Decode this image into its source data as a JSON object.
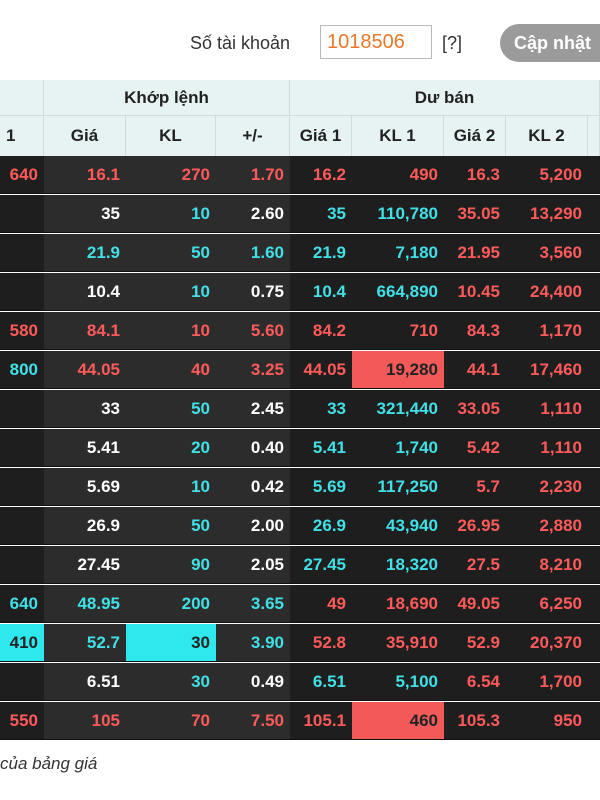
{
  "account": {
    "label": "Số tài khoản",
    "value": "1018506",
    "help": "[?]",
    "update_button": "Cập nhật"
  },
  "header": {
    "group_match": "Khớp lệnh",
    "group_ask": "Dư bán",
    "cols": [
      "1",
      "Giá",
      "KL",
      "+/-",
      "Giá 1",
      "KL 1",
      "Giá 2",
      "KL 2",
      ""
    ]
  },
  "rows": [
    {
      "bid": "640",
      "price": "16.1",
      "vol": "270",
      "chg": "1.70",
      "a1p": "16.2",
      "a1v": "490",
      "a2p": "16.3",
      "a2v": "5,200",
      "colors": [
        "red",
        "red",
        "red",
        "red",
        "red",
        "red",
        "red",
        "red"
      ]
    },
    {
      "bid": "",
      "price": "35",
      "vol": "10",
      "chg": "2.60",
      "a1p": "35",
      "a1v": "110,780",
      "a2p": "35.05",
      "a2v": "13,290",
      "colors": [
        "white",
        "white",
        "cyan",
        "white",
        "cyan",
        "cyan",
        "red",
        "red"
      ]
    },
    {
      "bid": "",
      "price": "21.9",
      "vol": "50",
      "chg": "1.60",
      "a1p": "21.9",
      "a1v": "7,180",
      "a2p": "21.95",
      "a2v": "3,560",
      "colors": [
        "white",
        "cyan",
        "cyan",
        "cyan",
        "cyan",
        "cyan",
        "red",
        "red"
      ]
    },
    {
      "bid": "",
      "price": "10.4",
      "vol": "10",
      "chg": "0.75",
      "a1p": "10.4",
      "a1v": "664,890",
      "a2p": "10.45",
      "a2v": "24,400",
      "colors": [
        "white",
        "white",
        "cyan",
        "white",
        "cyan",
        "cyan",
        "red",
        "red"
      ]
    },
    {
      "bid": "580",
      "price": "84.1",
      "vol": "10",
      "chg": "5.60",
      "a1p": "84.2",
      "a1v": "710",
      "a2p": "84.3",
      "a2v": "1,170",
      "colors": [
        "red",
        "red",
        "red",
        "red",
        "red",
        "red",
        "red",
        "red"
      ]
    },
    {
      "bid": "800",
      "price": "44.05",
      "vol": "40",
      "chg": "3.25",
      "a1p": "44.05",
      "a1v": "19,280",
      "a2p": "44.1",
      "a2v": "17,460",
      "colors": [
        "cyan",
        "red",
        "red",
        "red",
        "red",
        "hlred",
        "red",
        "red"
      ]
    },
    {
      "bid": "",
      "price": "33",
      "vol": "50",
      "chg": "2.45",
      "a1p": "33",
      "a1v": "321,440",
      "a2p": "33.05",
      "a2v": "1,110",
      "colors": [
        "white",
        "white",
        "cyan",
        "white",
        "cyan",
        "cyan",
        "red",
        "red"
      ]
    },
    {
      "bid": "",
      "price": "5.41",
      "vol": "20",
      "chg": "0.40",
      "a1p": "5.41",
      "a1v": "1,740",
      "a2p": "5.42",
      "a2v": "1,110",
      "colors": [
        "white",
        "white",
        "cyan",
        "white",
        "cyan",
        "cyan",
        "red",
        "red"
      ]
    },
    {
      "bid": "",
      "price": "5.69",
      "vol": "10",
      "chg": "0.42",
      "a1p": "5.69",
      "a1v": "117,250",
      "a2p": "5.7",
      "a2v": "2,230",
      "colors": [
        "white",
        "white",
        "cyan",
        "white",
        "cyan",
        "cyan",
        "red",
        "red"
      ]
    },
    {
      "bid": "",
      "price": "26.9",
      "vol": "50",
      "chg": "2.00",
      "a1p": "26.9",
      "a1v": "43,940",
      "a2p": "26.95",
      "a2v": "2,880",
      "colors": [
        "white",
        "white",
        "cyan",
        "white",
        "cyan",
        "cyan",
        "red",
        "red"
      ]
    },
    {
      "bid": "",
      "price": "27.45",
      "vol": "90",
      "chg": "2.05",
      "a1p": "27.45",
      "a1v": "18,320",
      "a2p": "27.5",
      "a2v": "8,210",
      "colors": [
        "white",
        "white",
        "cyan",
        "white",
        "cyan",
        "cyan",
        "red",
        "red"
      ]
    },
    {
      "bid": "640",
      "price": "48.95",
      "vol": "200",
      "chg": "3.65",
      "a1p": "49",
      "a1v": "18,690",
      "a2p": "49.05",
      "a2v": "6,250",
      "colors": [
        "cyan",
        "cyan",
        "cyan",
        "cyan",
        "red",
        "red",
        "red",
        "red"
      ]
    },
    {
      "bid": "410",
      "price": "52.7",
      "vol": "30",
      "chg": "3.90",
      "a1p": "52.8",
      "a1v": "35,910",
      "a2p": "52.9",
      "a2v": "20,370",
      "colors": [
        "hlcyan",
        "cyan",
        "hlcyan",
        "cyan",
        "red",
        "red",
        "red",
        "red"
      ]
    },
    {
      "bid": "",
      "price": "6.51",
      "vol": "30",
      "chg": "0.49",
      "a1p": "6.51",
      "a1v": "5,100",
      "a2p": "6.54",
      "a2v": "1,700",
      "colors": [
        "white",
        "white",
        "cyan",
        "white",
        "cyan",
        "cyan",
        "red",
        "red"
      ]
    },
    {
      "bid": "550",
      "price": "105",
      "vol": "70",
      "chg": "7.50",
      "a1p": "105.1",
      "a1v": "460",
      "a2p": "105.3",
      "a2v": "950",
      "colors": [
        "red",
        "red",
        "red",
        "red",
        "red",
        "hlred",
        "red",
        "red"
      ]
    }
  ],
  "footer": "của bảng giá"
}
